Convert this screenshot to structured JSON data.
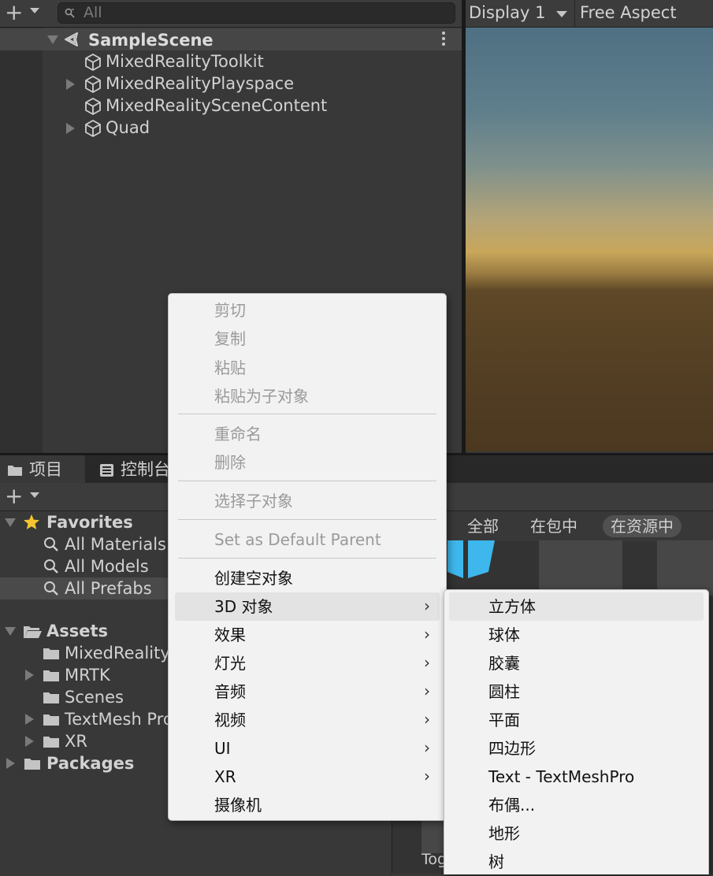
{
  "hierarchy": {
    "search_placeholder": "All",
    "scene_title": "SampleScene",
    "items": [
      {
        "label": "MixedRealityToolkit",
        "expandable": false
      },
      {
        "label": "MixedRealityPlayspace",
        "expandable": true
      },
      {
        "label": "MixedRealitySceneContent",
        "expandable": false
      },
      {
        "label": "Quad",
        "expandable": true
      }
    ]
  },
  "game": {
    "display": "Display 1",
    "aspect": "Free Aspect"
  },
  "project": {
    "tabs": [
      {
        "label": "项目",
        "icon": "folder-icon"
      },
      {
        "label": "控制台",
        "icon": "console-icon"
      }
    ],
    "favorites_label": "Favorites",
    "favorites": [
      "All Materials",
      "All Models",
      "All Prefabs"
    ],
    "assets_label": "Assets",
    "assets": [
      {
        "label": "MixedRealityT",
        "expandable": false
      },
      {
        "label": "MRTK",
        "expandable": true
      },
      {
        "label": "Scenes",
        "expandable": false
      },
      {
        "label": "TextMesh Pro",
        "expandable": true
      },
      {
        "label": "XR",
        "expandable": true
      }
    ],
    "packages_label": "Packages",
    "filters": [
      "全部",
      "在包中",
      "在资源中"
    ],
    "bottom_label": "Tog"
  },
  "context_menu": {
    "items": [
      {
        "label": "剪切",
        "disabled": true
      },
      {
        "label": "复制",
        "disabled": true
      },
      {
        "label": "粘贴",
        "disabled": true
      },
      {
        "label": "粘贴为子对象",
        "disabled": true
      },
      {
        "label": "重命名",
        "disabled": true
      },
      {
        "label": "删除",
        "disabled": true
      },
      {
        "label": "选择子对象",
        "disabled": true
      },
      {
        "label": "Set as Default Parent",
        "disabled": true
      },
      {
        "label": "创建空对象",
        "disabled": false
      },
      {
        "label": "3D 对象",
        "disabled": false,
        "submenu": true
      },
      {
        "label": "效果",
        "disabled": false,
        "submenu": true
      },
      {
        "label": "灯光",
        "disabled": false,
        "submenu": true
      },
      {
        "label": "音频",
        "disabled": false,
        "submenu": true
      },
      {
        "label": "视频",
        "disabled": false,
        "submenu": true
      },
      {
        "label": "UI",
        "disabled": false,
        "submenu": true
      },
      {
        "label": "XR",
        "disabled": false,
        "submenu": true
      },
      {
        "label": "摄像机",
        "disabled": false
      }
    ],
    "submenu_arrow": "›"
  },
  "submenu_3d": {
    "items": [
      "立方体",
      "球体",
      "胶囊",
      "圆柱",
      "平面",
      "四边形",
      "Text - TextMeshPro",
      "布偶...",
      "地形",
      "树"
    ]
  },
  "colors": {
    "panel_bg": "#383838",
    "menu_bg": "#f2f2f2",
    "menu_highlight": "#e3e3e3",
    "favorite_star": "#f4c430",
    "prefab_blue": "#3db7ec"
  }
}
